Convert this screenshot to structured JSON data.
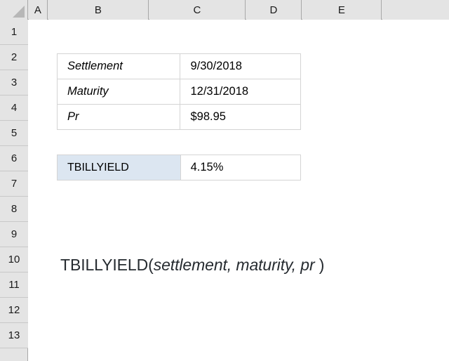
{
  "spreadsheet": {
    "select_all_label": "select-all",
    "column_headers": [
      "A",
      "B",
      "C",
      "D",
      "E"
    ],
    "row_headers": [
      "1",
      "2",
      "3",
      "4",
      "5",
      "6",
      "7",
      "8",
      "9",
      "10",
      "11",
      "12",
      "13"
    ],
    "colors": {
      "header_background": "#e4e4e4",
      "header_border": "#a8a8a8",
      "cell_border": "#d4d4d4",
      "highlight_cell": "#dce6f1",
      "grid_background": "#ffffff",
      "text": "#000000",
      "syntax_text": "#262b30"
    }
  },
  "inputs_table": {
    "rows": [
      {
        "label": "Settlement",
        "value": "9/30/2018"
      },
      {
        "label": "Maturity",
        "value": "12/31/2018"
      },
      {
        "label": "Pr",
        "value": "$98.95"
      }
    ]
  },
  "result_table": {
    "rows": [
      {
        "label": "TBILLYIELD",
        "value": "4.15%"
      }
    ]
  },
  "syntax": {
    "function_name": "TBILLYIELD(",
    "arguments": "settlement, maturity, pr",
    "closing": " )"
  }
}
